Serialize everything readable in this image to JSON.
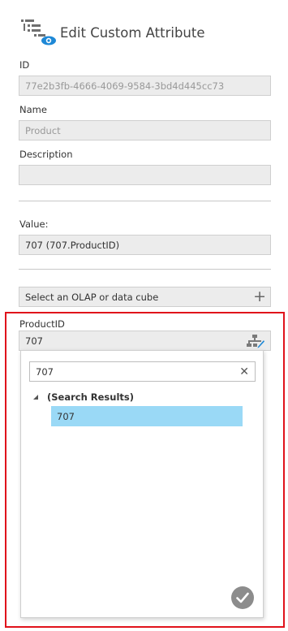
{
  "header": {
    "title": "Edit Custom Attribute",
    "icon": "custom-attribute-view-icon"
  },
  "fields": {
    "id": {
      "label": "ID",
      "value": "77e2b3fb-4666-4069-9584-3bd4d445cc73"
    },
    "name": {
      "label": "Name",
      "value": "Product"
    },
    "description": {
      "label": "Description",
      "value": ""
    },
    "value": {
      "label": "Value:",
      "value": "707 (707.ProductID)"
    }
  },
  "olap": {
    "label": "Select an OLAP or data cube",
    "icon": "plus-icon"
  },
  "product_id": {
    "label": "ProductID",
    "value": "707",
    "icon": "hierarchy-edit-icon"
  },
  "dropdown": {
    "search_value": "707",
    "clear_symbol": "✕",
    "tree_root_label": "(Search Results)",
    "tree_items": [
      "707"
    ],
    "selected_color": "#9ad9f6"
  },
  "colors": {
    "highlight_frame": "#e0121b",
    "field_bg": "#ececec",
    "accent_blue": "#1e88d6"
  }
}
